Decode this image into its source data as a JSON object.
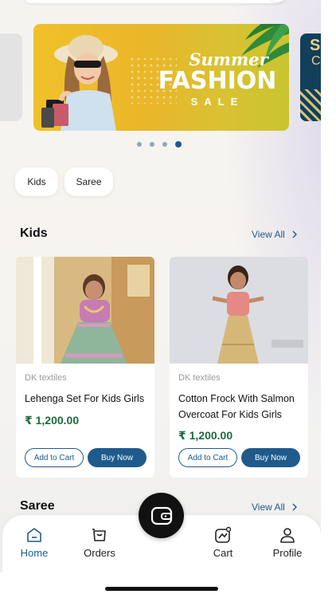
{
  "banner": {
    "title_line1": "Summer",
    "title_line2": "FASHION",
    "title_line3": "SALE",
    "peek_letter1": "S",
    "peek_letter2": "C",
    "slide_count": 4,
    "active_slide": 4
  },
  "chips": [
    {
      "label": "Kids"
    },
    {
      "label": "Saree"
    }
  ],
  "sections": {
    "kids": {
      "title": "Kids",
      "view_all": "View All"
    },
    "saree": {
      "title": "Saree",
      "view_all": "View All"
    }
  },
  "products": [
    {
      "seller": "DK textiles",
      "name": "Lehenga Set For Kids Girls",
      "price": "₹ 1,200.00",
      "add_to_cart": "Add to Cart",
      "buy_now": "Buy Now"
    },
    {
      "seller": "DK textiles",
      "name": "Cotton Frock With Salmon Overcoat For Kids Girls",
      "price": "₹ 1,200.00",
      "add_to_cart": "Add to Cart",
      "buy_now": "Buy Now"
    }
  ],
  "nav": {
    "home": "Home",
    "orders": "Orders",
    "cart": "Cart",
    "profile": "Profile",
    "active": "home"
  },
  "colors": {
    "accent": "#1e5b8c",
    "price": "#1c6b3a",
    "banner_yellow": "#f0c12a"
  },
  "icons": {
    "home": "home-icon",
    "orders": "shopping-bag-icon",
    "center": "wallet-icon",
    "cart": "chart-icon",
    "profile": "user-icon",
    "view_all": "chevron-right-icon"
  }
}
